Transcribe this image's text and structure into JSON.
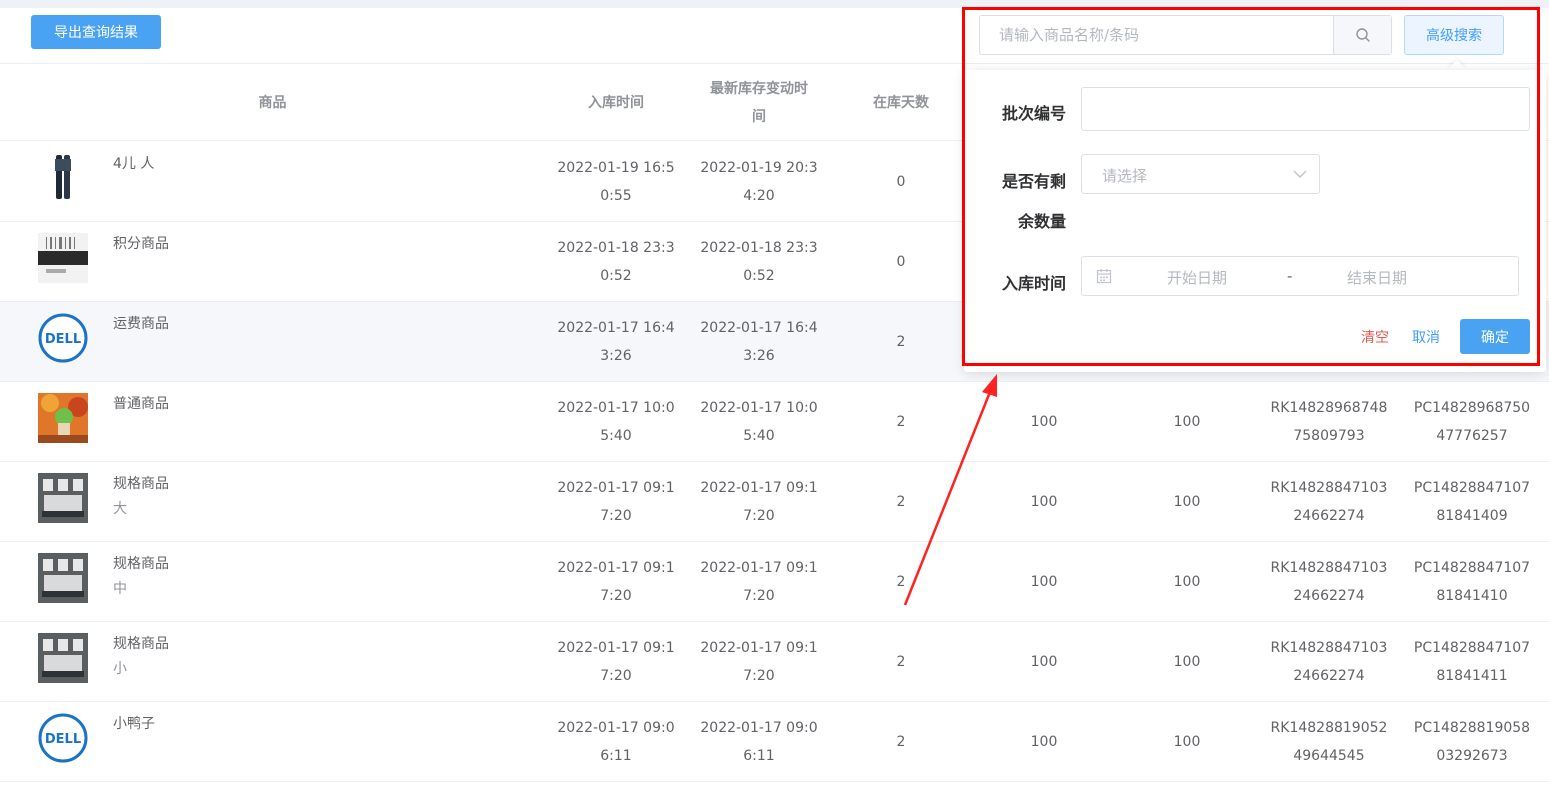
{
  "toolbar": {
    "export_label": "导出查询结果",
    "search_placeholder": "请输入商品名称/条码",
    "advanced_label": "高级搜索"
  },
  "table": {
    "headers": [
      "商品",
      "入库时间",
      "最新库存变动时\n间",
      "在库天数"
    ],
    "rows": [
      {
        "name": "4儿 人",
        "spec": "",
        "thumb": "brush",
        "in_time": "2022-01-19 16:5\n0:55",
        "change_time": "2022-01-19 20:3\n4:20",
        "days": "0",
        "qty1": "",
        "qty2": "",
        "rk": "",
        "pc": ""
      },
      {
        "name": "积分商品",
        "spec": "",
        "thumb": "barcode",
        "in_time": "2022-01-18 23:3\n0:52",
        "change_time": "2022-01-18 23:3\n0:52",
        "days": "0",
        "qty1": "",
        "qty2": "",
        "rk": "",
        "pc": ""
      },
      {
        "name": "运费商品",
        "spec": "",
        "thumb": "dell",
        "in_time": "2022-01-17 16:4\n3:26",
        "change_time": "2022-01-17 16:4\n3:26",
        "days": "2",
        "qty1": "",
        "qty2": "",
        "rk": "",
        "pc": ""
      },
      {
        "name": "普通商品",
        "spec": "",
        "thumb": "autumn",
        "in_time": "2022-01-17 10:0\n5:40",
        "change_time": "2022-01-17 10:0\n5:40",
        "days": "2",
        "qty1": "100",
        "qty2": "100",
        "rk": "RK14828968748\n75809793",
        "pc": "PC14828968750\n47776257"
      },
      {
        "name": "规格商品",
        "spec": "大",
        "thumb": "bed",
        "in_time": "2022-01-17 09:1\n7:20",
        "change_time": "2022-01-17 09:1\n7:20",
        "days": "2",
        "qty1": "100",
        "qty2": "100",
        "rk": "RK14828847103\n24662274",
        "pc": "PC14828847107\n81841409"
      },
      {
        "name": "规格商品",
        "spec": "中",
        "thumb": "bed",
        "in_time": "2022-01-17 09:1\n7:20",
        "change_time": "2022-01-17 09:1\n7:20",
        "days": "2",
        "qty1": "100",
        "qty2": "100",
        "rk": "RK14828847103\n24662274",
        "pc": "PC14828847107\n81841410"
      },
      {
        "name": "规格商品",
        "spec": "小",
        "thumb": "bed",
        "in_time": "2022-01-17 09:1\n7:20",
        "change_time": "2022-01-17 09:1\n7:20",
        "days": "2",
        "qty1": "100",
        "qty2": "100",
        "rk": "RK14828847103\n24662274",
        "pc": "PC14828847107\n81841411"
      },
      {
        "name": "小鸭子",
        "spec": "",
        "thumb": "dell",
        "in_time": "2022-01-17 09:0\n6:11",
        "change_time": "2022-01-17 09:0\n6:11",
        "days": "2",
        "qty1": "100",
        "qty2": "100",
        "rk": "RK14828819052\n49644545",
        "pc": "PC14828819058\n03292673"
      }
    ]
  },
  "advanced_search": {
    "batch_label": "批次编号",
    "batch_value": "",
    "remaining_label": "是否有剩\n余数量",
    "remaining_placeholder": "请选择",
    "in_time_label": "入库时间",
    "start_placeholder": "开始日期",
    "range_separator": "-",
    "end_placeholder": "结束日期",
    "clear_label": "清空",
    "cancel_label": "取消",
    "confirm_label": "确定"
  },
  "colors": {
    "primary": "#4aa3f2",
    "link": "#409eff",
    "danger": "#e5584c",
    "annotation": "#ff0000",
    "hover_row": "#f5f7fa"
  }
}
